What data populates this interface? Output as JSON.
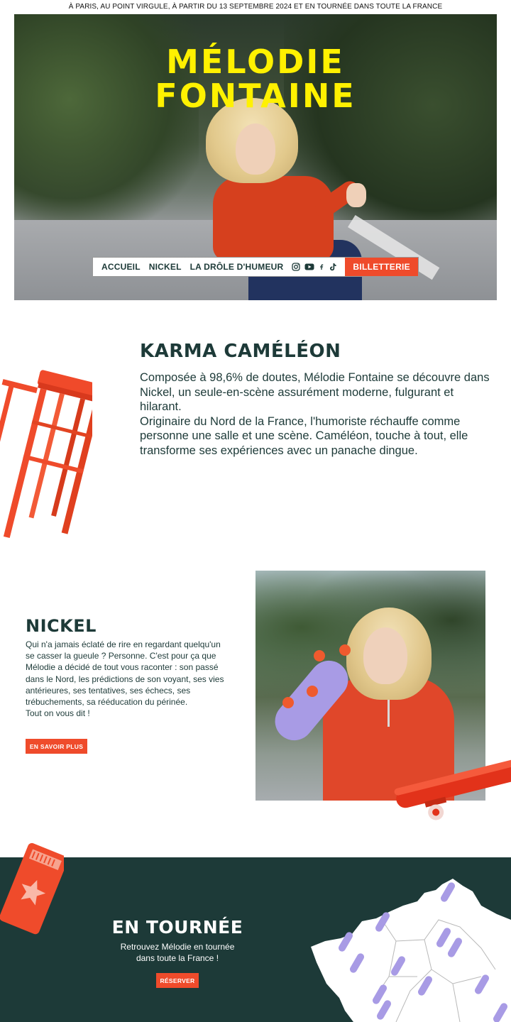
{
  "topbar": {
    "text": "À PARIS, AU POINT VIRGULE, À PARTIR DU 13 SEPTEMBRE 2024 ET EN TOURNÉE DANS TOUTE LA FRANCE"
  },
  "hero": {
    "title_line1": "MÉLODIE",
    "title_line2": "FONTAINE"
  },
  "nav": {
    "items": [
      {
        "label": "ACCUEIL"
      },
      {
        "label": "NICKEL"
      },
      {
        "label": "LA DRÔLE D'HUMEUR"
      }
    ],
    "social_icons": [
      "instagram-icon",
      "youtube-icon",
      "facebook-icon",
      "tiktok-icon"
    ],
    "cta": "BILLETTERIE"
  },
  "karma": {
    "title": "KARMA CAMÉLÉON",
    "paragraph1": "Composée à 98,6% de doutes, Mélodie Fontaine se découvre dans Nickel, un seule-en-scène assurément moderne, fulgurant et hilarant.",
    "paragraph2": "Originaire du Nord de la France, l'humoriste réchauffe comme personne une salle et une scène. Caméléon, touche à tout, elle transforme ses expériences avec un panache dingue."
  },
  "nickel": {
    "title": "NICKEL",
    "paragraph": "Qui n'a jamais éclaté de rire en regardant quelqu'un se casser la gueule ? Personne. C'est pour ça que Mélodie a décidé de tout vous raconter : son passé dans le Nord, les prédictions de son voyant, ses vies antérieures, ses tentatives, ses échecs, ses trébuchements, sa rééducation du périnée.",
    "closing": "Tout on vous dit !",
    "button": "EN SAVOIR PLUS"
  },
  "tour": {
    "title": "EN TOURNÉE",
    "line1": "Retrouvez Mélodie en tournée",
    "line2": "dans toute la France !",
    "button": "RÉSERVER"
  },
  "colors": {
    "accent": "#ef4b2b",
    "dark_green": "#1d3a38",
    "title_yellow": "#fff100",
    "board_purple": "#a89be5"
  }
}
